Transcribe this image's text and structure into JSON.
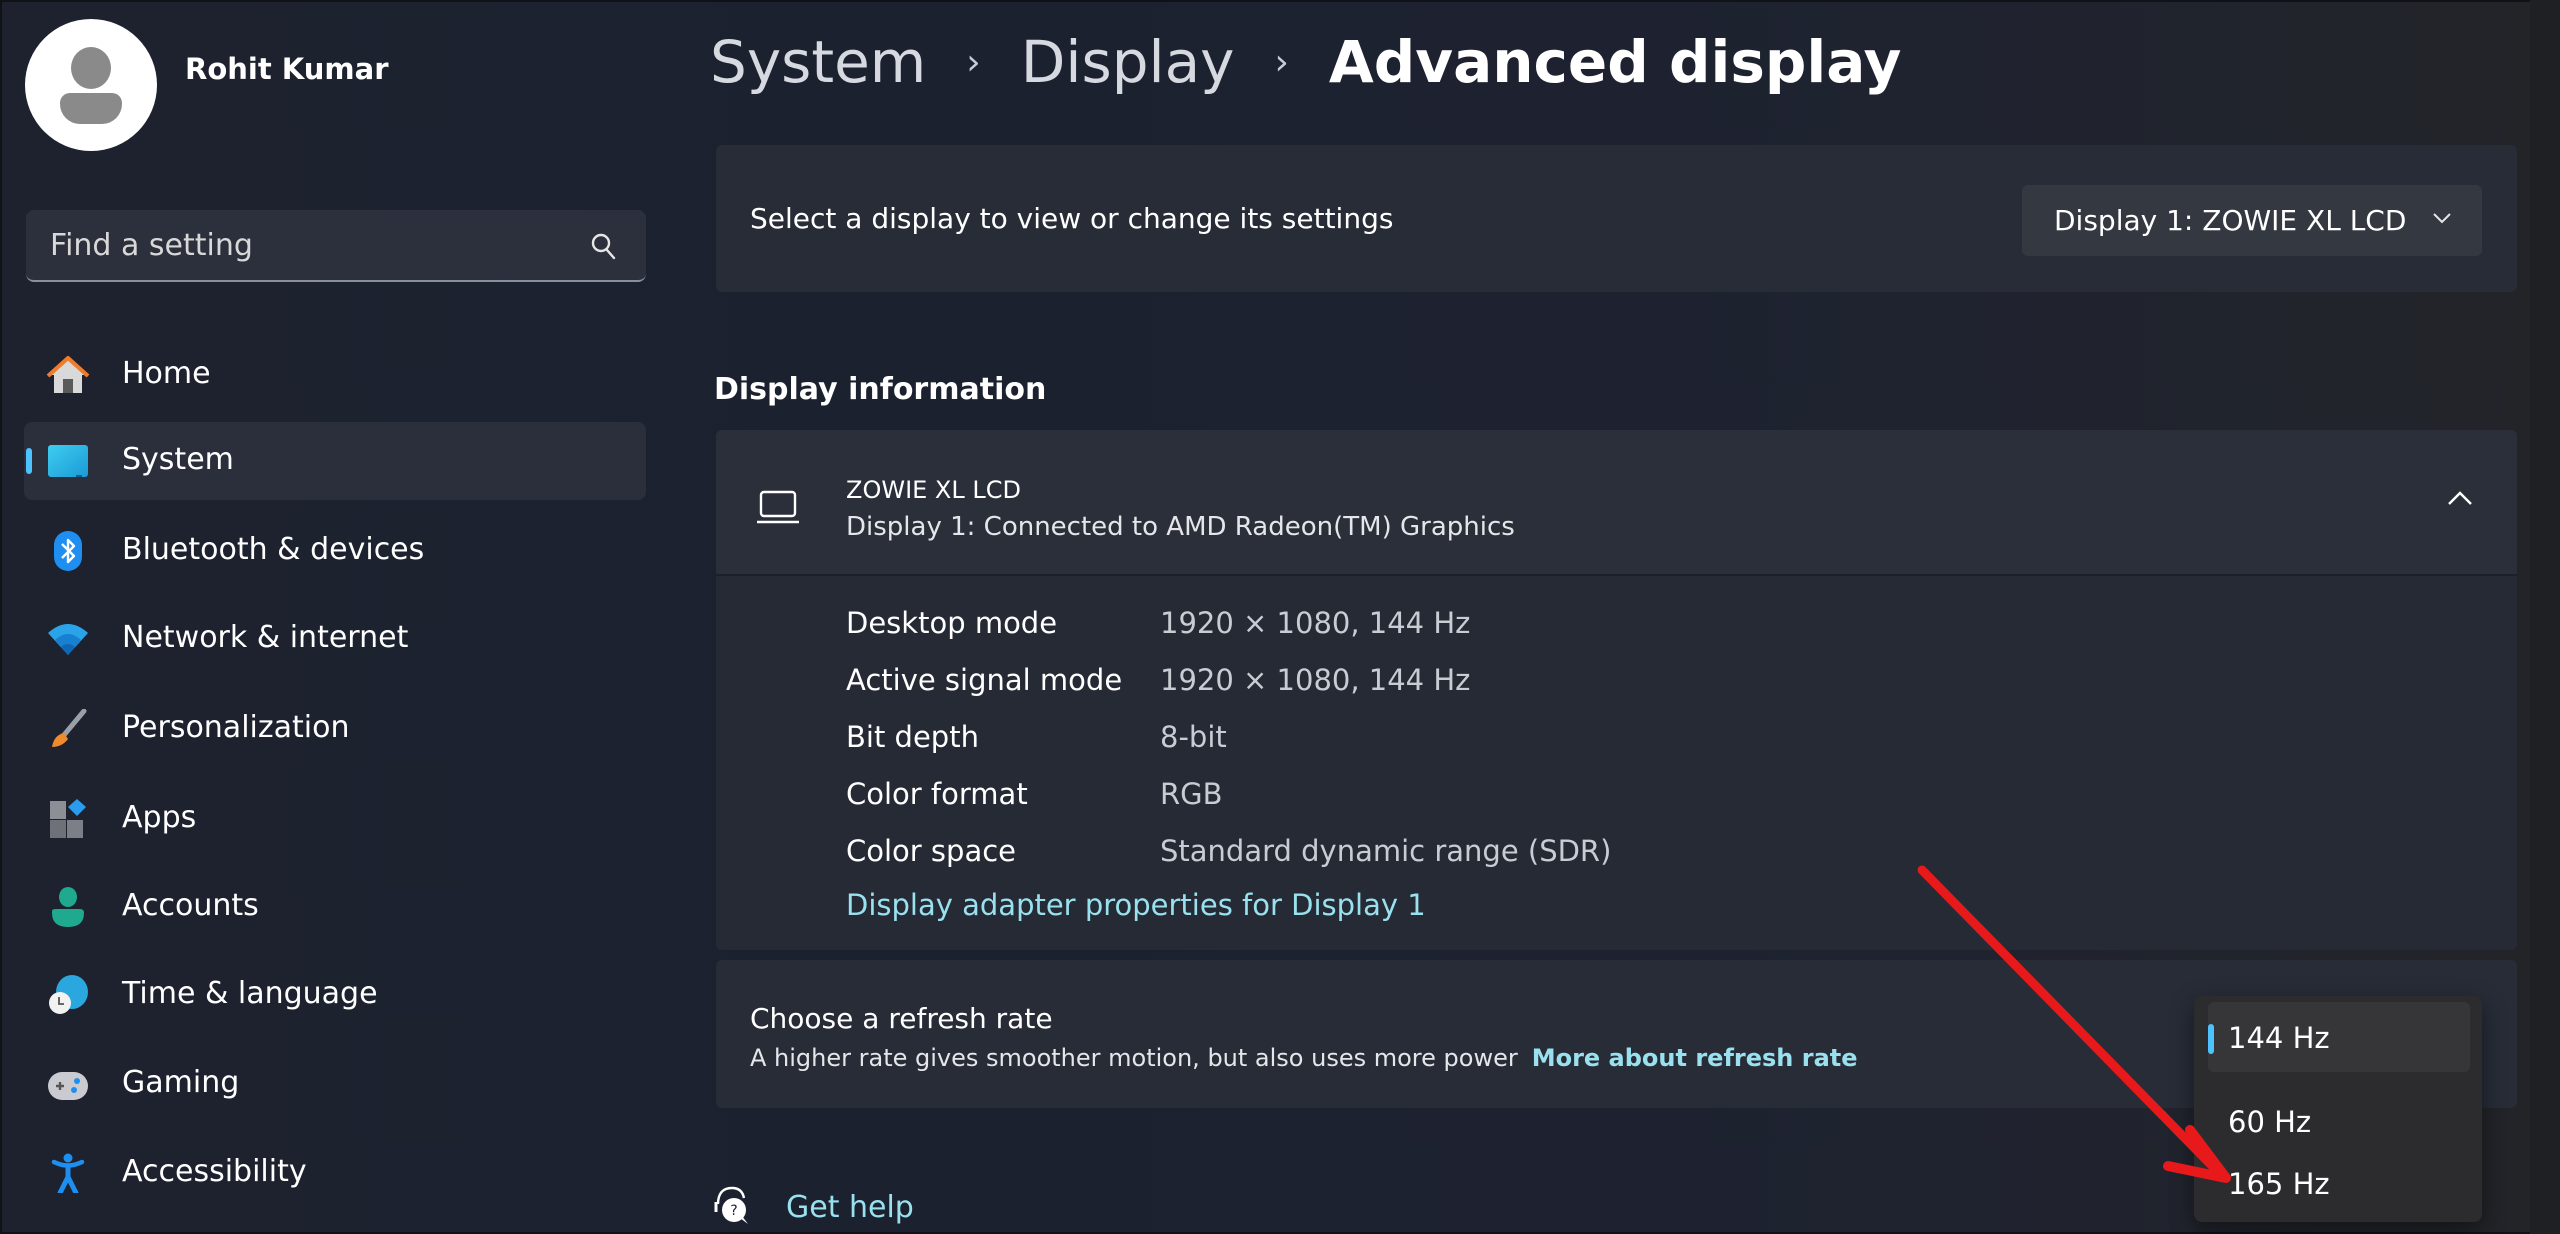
{
  "user": {
    "name": "Rohit Kumar"
  },
  "search": {
    "placeholder": "Find a setting",
    "value": ""
  },
  "sidebar": {
    "items": [
      {
        "label": "Home",
        "icon": "home-icon",
        "selected": false
      },
      {
        "label": "System",
        "icon": "system-monitor-icon",
        "selected": true
      },
      {
        "label": "Bluetooth & devices",
        "icon": "bluetooth-icon",
        "selected": false
      },
      {
        "label": "Network & internet",
        "icon": "wifi-icon",
        "selected": false
      },
      {
        "label": "Personalization",
        "icon": "paintbrush-icon",
        "selected": false
      },
      {
        "label": "Apps",
        "icon": "apps-icon",
        "selected": false
      },
      {
        "label": "Accounts",
        "icon": "person-icon",
        "selected": false
      },
      {
        "label": "Time & language",
        "icon": "globe-clock-icon",
        "selected": false
      },
      {
        "label": "Gaming",
        "icon": "gamepad-icon",
        "selected": false
      },
      {
        "label": "Accessibility",
        "icon": "accessibility-icon",
        "selected": false
      }
    ]
  },
  "breadcrumb": {
    "items": [
      "System",
      "Display",
      "Advanced display"
    ],
    "separator": "›"
  },
  "select_display": {
    "label": "Select a display to view or change its settings",
    "selected_value": "Display 1: ZOWIE XL LCD"
  },
  "display_information": {
    "heading": "Display information",
    "monitor_name": "ZOWIE XL LCD",
    "connection": "Display 1: Connected to AMD Radeon(TM) Graphics",
    "expanded": true,
    "rows": [
      {
        "key": "Desktop mode",
        "value": "1920 × 1080, 144 Hz"
      },
      {
        "key": "Active signal mode",
        "value": "1920 × 1080, 144 Hz"
      },
      {
        "key": "Bit depth",
        "value": "8-bit"
      },
      {
        "key": "Color format",
        "value": "RGB"
      },
      {
        "key": "Color space",
        "value": "Standard dynamic range (SDR)"
      }
    ],
    "adapter_link": "Display adapter properties for Display 1"
  },
  "refresh_rate": {
    "title": "Choose a refresh rate",
    "description": "A higher rate gives smoother motion, but also uses more power",
    "more_link": "More about refresh rate",
    "selected": "144 Hz",
    "options": [
      "144 Hz",
      "60 Hz",
      "165 Hz"
    ]
  },
  "help": {
    "label": "Get help"
  },
  "annotation": {
    "type": "arrow",
    "color": "#e8191a",
    "points_to": "165 Hz"
  },
  "colors": {
    "accent": "#4cc2ff",
    "link": "#99e1ee",
    "background": "#1c2230",
    "card": "#272c37"
  }
}
